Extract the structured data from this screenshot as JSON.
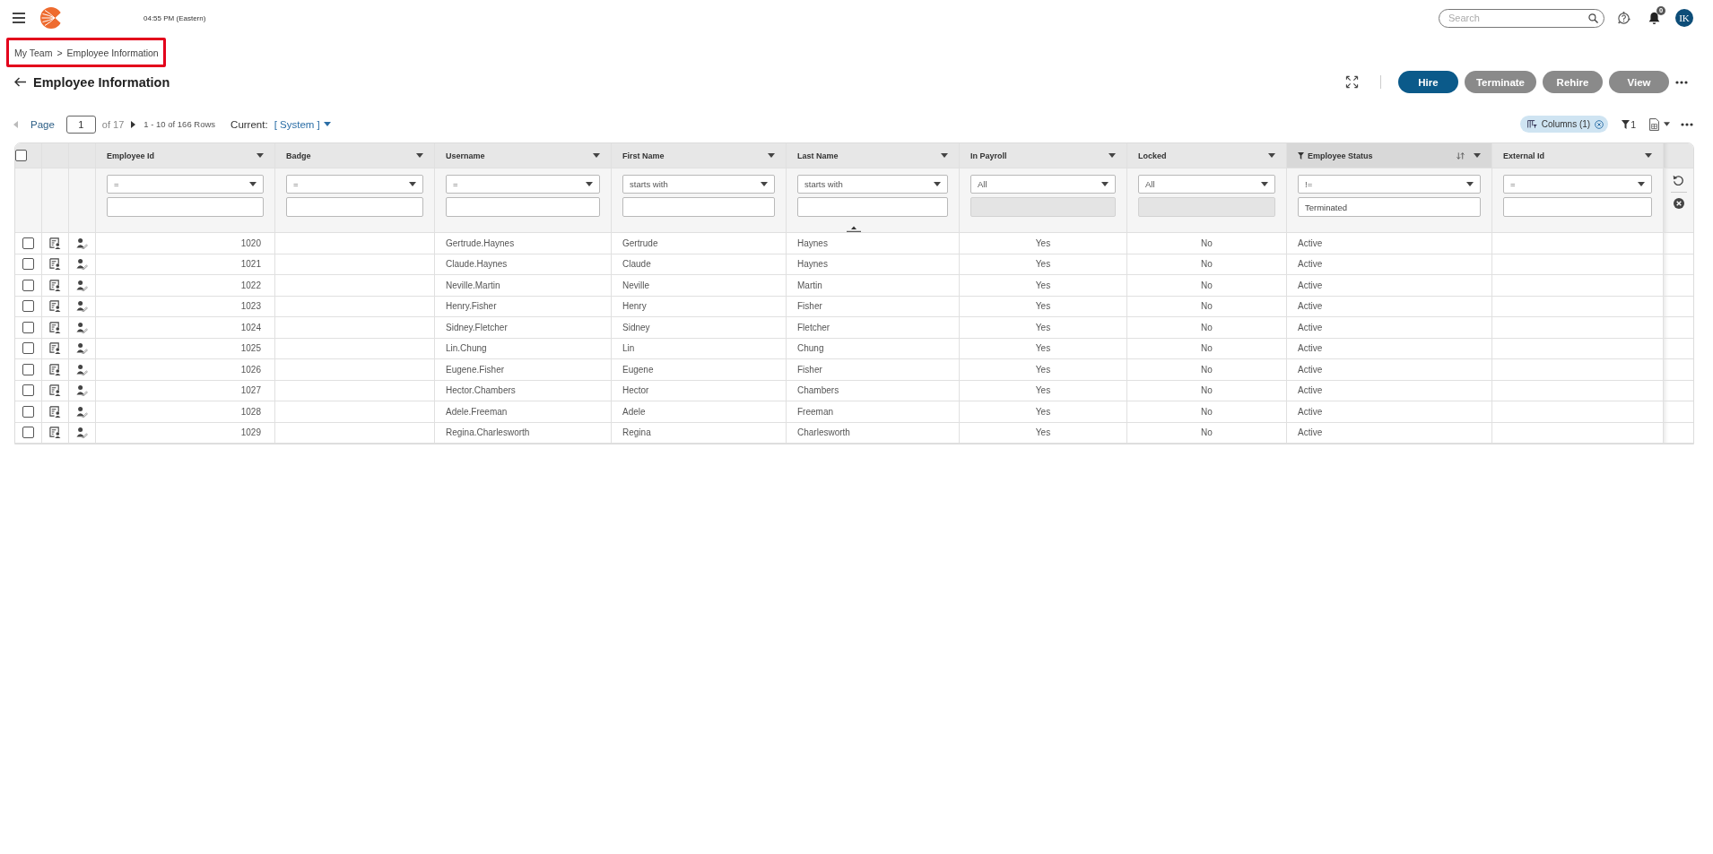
{
  "header": {
    "time": "04:55 PM (Eastern)",
    "search": {
      "placeholder": "Search"
    },
    "notification_count": "0",
    "avatar": "IK"
  },
  "breadcrumb": {
    "highlighted": true,
    "items": [
      "My Team",
      "Employee Information"
    ],
    "separator": ">"
  },
  "page_title": "Employee Information",
  "actions": [
    {
      "label": "Hire",
      "disabled": false
    },
    {
      "label": "Terminate",
      "disabled": true
    },
    {
      "label": "Rehire",
      "disabled": true
    },
    {
      "label": "View",
      "disabled": true
    }
  ],
  "pager": {
    "prev_disabled": true,
    "next_disabled": false,
    "label": "Page",
    "page": "1",
    "total": "of 17",
    "range": "1 - 10 of 166 Rows",
    "view_label": "Current:",
    "view": "[ System ]"
  },
  "toolbar": {
    "columns_chip": "Columns (1)",
    "filter_count": "1"
  },
  "table": {
    "all_checked": false,
    "columns": [
      {
        "label": "Employee Id",
        "kind": "number",
        "filtered": false,
        "sorted": false,
        "filter": {
          "operator": "=",
          "disabled": false
        }
      },
      {
        "label": "Badge",
        "kind": "text",
        "filtered": false,
        "sorted": false,
        "filter": {
          "operator": "=",
          "disabled": false
        }
      },
      {
        "label": "Username",
        "kind": "text",
        "filtered": false,
        "sorted": false,
        "filter": {
          "operator": "=",
          "disabled": false
        }
      },
      {
        "label": "First Name",
        "kind": "text",
        "filtered": false,
        "sorted": false,
        "filter": {
          "operator": "starts with",
          "disabled": false
        }
      },
      {
        "label": "Last Name",
        "kind": "text",
        "filtered": false,
        "sorted": false,
        "filter": {
          "operator": "starts with",
          "disabled": false
        }
      },
      {
        "label": "In Payroll",
        "kind": "flag",
        "filtered": false,
        "sorted": false,
        "filter": {
          "operator": "All",
          "disabled": true
        }
      },
      {
        "label": "Locked",
        "kind": "flag",
        "filtered": false,
        "sorted": false,
        "filter": {
          "operator": "All",
          "disabled": true
        }
      },
      {
        "label": "Employee Status",
        "kind": "text",
        "filtered": true,
        "sorted": true,
        "filter": {
          "operator": "!=",
          "value": "Terminated",
          "disabled": false
        }
      },
      {
        "label": "External Id",
        "kind": "text",
        "filtered": false,
        "sorted": false,
        "filter": {
          "operator": "=",
          "disabled": false
        }
      }
    ],
    "rows": [
      {
        "checked": false,
        "cells": [
          "1020",
          null,
          "Gertrude.Haynes",
          "Gertrude",
          "Haynes",
          "Yes",
          "No",
          "Active",
          null
        ]
      },
      {
        "checked": false,
        "cells": [
          "1021",
          null,
          "Claude.Haynes",
          "Claude",
          "Haynes",
          "Yes",
          "No",
          "Active",
          null
        ]
      },
      {
        "checked": false,
        "cells": [
          "1022",
          null,
          "Neville.Martin",
          "Neville",
          "Martin",
          "Yes",
          "No",
          "Active",
          null
        ]
      },
      {
        "checked": false,
        "cells": [
          "1023",
          null,
          "Henry.Fisher",
          "Henry",
          "Fisher",
          "Yes",
          "No",
          "Active",
          null
        ]
      },
      {
        "checked": false,
        "cells": [
          "1024",
          null,
          "Sidney.Fletcher",
          "Sidney",
          "Fletcher",
          "Yes",
          "No",
          "Active",
          null
        ]
      },
      {
        "checked": false,
        "cells": [
          "1025",
          null,
          "Lin.Chung",
          "Lin",
          "Chung",
          "Yes",
          "No",
          "Active",
          null
        ]
      },
      {
        "checked": false,
        "cells": [
          "1026",
          null,
          "Eugene.Fisher",
          "Eugene",
          "Fisher",
          "Yes",
          "No",
          "Active",
          null
        ]
      },
      {
        "checked": false,
        "cells": [
          "1027",
          null,
          "Hector.Chambers",
          "Hector",
          "Chambers",
          "Yes",
          "No",
          "Active",
          null
        ]
      },
      {
        "checked": false,
        "cells": [
          "1028",
          null,
          "Adele.Freeman",
          "Adele",
          "Freeman",
          "Yes",
          "No",
          "Active",
          null
        ]
      },
      {
        "checked": false,
        "cells": [
          "1029",
          null,
          "Regina.Charlesworth",
          "Regina",
          "Charlesworth",
          "Yes",
          "No",
          "Active",
          null
        ]
      }
    ]
  }
}
